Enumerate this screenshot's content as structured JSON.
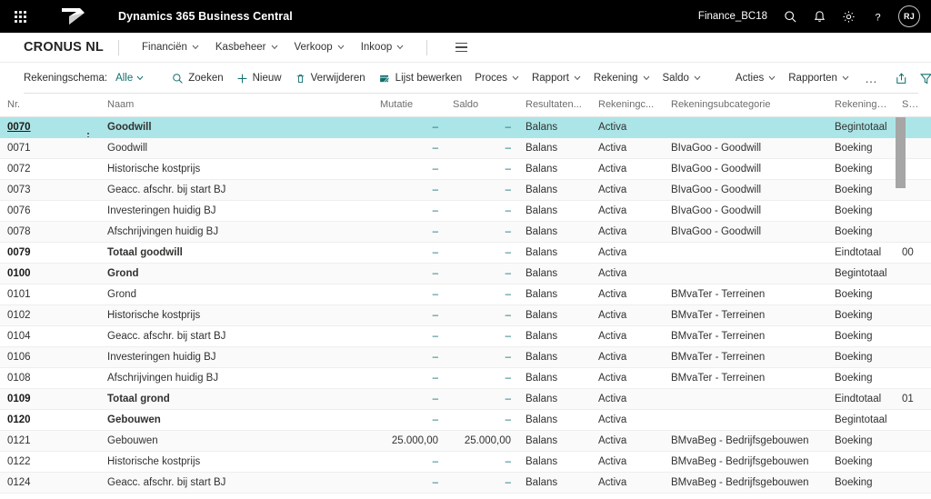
{
  "topbar": {
    "waffle_label": "App launcher",
    "app_title": "Dynamics 365 Business Central",
    "environment": "Finance_BC18",
    "search_icon": "search-icon",
    "notifications_icon": "bell-icon",
    "settings_icon": "gear-icon",
    "help_icon": "question-icon",
    "avatar_initials": "RJ"
  },
  "navbar": {
    "company": "CRONUS NL",
    "items": [
      {
        "label": "Financiën",
        "caret": "⌄"
      },
      {
        "label": "Kasbeheer",
        "caret": "⌄"
      },
      {
        "label": "Verkoop",
        "caret": "⌄"
      },
      {
        "label": "Inkoop",
        "caret": "⌄"
      }
    ],
    "menu_icon": "hamburger-icon"
  },
  "toolbar": {
    "view_label": "Rekeningschema:",
    "view_value": "Alle",
    "buttons": [
      {
        "label": "Zoeken",
        "icon": "search-icon"
      },
      {
        "label": "Nieuw",
        "icon": "plus-icon"
      },
      {
        "label": "Verwijderen",
        "icon": "trash-icon"
      },
      {
        "label": "Lijst bewerken",
        "icon": "edit-list-icon"
      },
      {
        "label": "Proces",
        "icon": "chevron-down-icon"
      },
      {
        "label": "Rapport",
        "icon": "chevron-down-icon"
      },
      {
        "label": "Rekening",
        "icon": "chevron-down-icon"
      },
      {
        "label": "Saldo",
        "icon": "chevron-down-icon"
      }
    ],
    "buttons2": [
      {
        "label": "Acties",
        "icon": "chevron-down-icon"
      },
      {
        "label": "Rapporten",
        "icon": "chevron-down-icon"
      }
    ],
    "overflow": "…",
    "icons": [
      {
        "name": "share-icon"
      },
      {
        "name": "filter-icon"
      },
      {
        "name": "info-icon"
      },
      {
        "name": "collapse-icon"
      },
      {
        "name": "bookmark-icon"
      }
    ],
    "accent_color": "#0f6e6e"
  },
  "grid": {
    "columns": [
      {
        "key": "nr",
        "label": "Nr.",
        "align": "left"
      },
      {
        "key": "naam",
        "label": "Naam",
        "align": "left"
      },
      {
        "key": "mutatie",
        "label": "Mutatie",
        "align": "right"
      },
      {
        "key": "saldo",
        "label": "Saldo",
        "align": "right"
      },
      {
        "key": "res",
        "label": "Resultaten...",
        "align": "left"
      },
      {
        "key": "cat",
        "label": "Rekeningc...",
        "align": "left"
      },
      {
        "key": "subcat",
        "label": "Rekeningsubcategorie",
        "align": "left"
      },
      {
        "key": "type",
        "label": "Rekenings...",
        "align": "left"
      },
      {
        "key": "same",
        "label": "Same",
        "align": "left"
      }
    ],
    "selected_row_color": "#ace5e7",
    "rows": [
      {
        "nr": "0070",
        "naam": "Goodwill",
        "mutatie": "–",
        "saldo": "–",
        "res": "Balans",
        "cat": "Activa",
        "subcat": "",
        "type": "Begintotaal",
        "same": "",
        "bold": true,
        "selected": true
      },
      {
        "nr": "0071",
        "naam": "Goodwill",
        "mutatie": "–",
        "saldo": "–",
        "res": "Balans",
        "cat": "Activa",
        "subcat": "BIvaGoo - Goodwill",
        "type": "Boeking",
        "same": "",
        "bold": false,
        "selected": false
      },
      {
        "nr": "0072",
        "naam": "Historische kostprijs",
        "mutatie": "–",
        "saldo": "–",
        "res": "Balans",
        "cat": "Activa",
        "subcat": "BIvaGoo - Goodwill",
        "type": "Boeking",
        "same": "",
        "bold": false,
        "selected": false
      },
      {
        "nr": "0073",
        "naam": "Geacc. afschr. bij start BJ",
        "mutatie": "–",
        "saldo": "–",
        "res": "Balans",
        "cat": "Activa",
        "subcat": "BIvaGoo - Goodwill",
        "type": "Boeking",
        "same": "",
        "bold": false,
        "selected": false
      },
      {
        "nr": "0076",
        "naam": "Investeringen huidig BJ",
        "mutatie": "–",
        "saldo": "–",
        "res": "Balans",
        "cat": "Activa",
        "subcat": "BIvaGoo - Goodwill",
        "type": "Boeking",
        "same": "",
        "bold": false,
        "selected": false
      },
      {
        "nr": "0078",
        "naam": "Afschrijvingen huidig BJ",
        "mutatie": "–",
        "saldo": "–",
        "res": "Balans",
        "cat": "Activa",
        "subcat": "BIvaGoo - Goodwill",
        "type": "Boeking",
        "same": "",
        "bold": false,
        "selected": false
      },
      {
        "nr": "0079",
        "naam": "Totaal goodwill",
        "mutatie": "–",
        "saldo": "–",
        "res": "Balans",
        "cat": "Activa",
        "subcat": "",
        "type": "Eindtotaal",
        "same": "00",
        "bold": true,
        "selected": false
      },
      {
        "nr": "0100",
        "naam": "Grond",
        "mutatie": "–",
        "saldo": "–",
        "res": "Balans",
        "cat": "Activa",
        "subcat": "",
        "type": "Begintotaal",
        "same": "",
        "bold": true,
        "selected": false
      },
      {
        "nr": "0101",
        "naam": "Grond",
        "mutatie": "–",
        "saldo": "–",
        "res": "Balans",
        "cat": "Activa",
        "subcat": "BMvaTer - Terreinen",
        "type": "Boeking",
        "same": "",
        "bold": false,
        "selected": false
      },
      {
        "nr": "0102",
        "naam": "Historische kostprijs",
        "mutatie": "–",
        "saldo": "–",
        "res": "Balans",
        "cat": "Activa",
        "subcat": "BMvaTer - Terreinen",
        "type": "Boeking",
        "same": "",
        "bold": false,
        "selected": false
      },
      {
        "nr": "0104",
        "naam": "Geacc. afschr. bij start BJ",
        "mutatie": "–",
        "saldo": "–",
        "res": "Balans",
        "cat": "Activa",
        "subcat": "BMvaTer - Terreinen",
        "type": "Boeking",
        "same": "",
        "bold": false,
        "selected": false
      },
      {
        "nr": "0106",
        "naam": "Investeringen huidig BJ",
        "mutatie": "–",
        "saldo": "–",
        "res": "Balans",
        "cat": "Activa",
        "subcat": "BMvaTer - Terreinen",
        "type": "Boeking",
        "same": "",
        "bold": false,
        "selected": false
      },
      {
        "nr": "0108",
        "naam": "Afschrijvingen huidig BJ",
        "mutatie": "–",
        "saldo": "–",
        "res": "Balans",
        "cat": "Activa",
        "subcat": "BMvaTer - Terreinen",
        "type": "Boeking",
        "same": "",
        "bold": false,
        "selected": false
      },
      {
        "nr": "0109",
        "naam": "Totaal grond",
        "mutatie": "–",
        "saldo": "–",
        "res": "Balans",
        "cat": "Activa",
        "subcat": "",
        "type": "Eindtotaal",
        "same": "01",
        "bold": true,
        "selected": false
      },
      {
        "nr": "0120",
        "naam": "Gebouwen",
        "mutatie": "–",
        "saldo": "–",
        "res": "Balans",
        "cat": "Activa",
        "subcat": "",
        "type": "Begintotaal",
        "same": "",
        "bold": true,
        "selected": false
      },
      {
        "nr": "0121",
        "naam": "Gebouwen",
        "mutatie": "25.000,00",
        "saldo": "25.000,00",
        "res": "Balans",
        "cat": "Activa",
        "subcat": "BMvaBeg - Bedrijfsgebouwen",
        "type": "Boeking",
        "same": "",
        "bold": false,
        "selected": false
      },
      {
        "nr": "0122",
        "naam": "Historische kostprijs",
        "mutatie": "–",
        "saldo": "–",
        "res": "Balans",
        "cat": "Activa",
        "subcat": "BMvaBeg - Bedrijfsgebouwen",
        "type": "Boeking",
        "same": "",
        "bold": false,
        "selected": false
      },
      {
        "nr": "0124",
        "naam": "Geacc. afschr. bij start BJ",
        "mutatie": "–",
        "saldo": "–",
        "res": "Balans",
        "cat": "Activa",
        "subcat": "BMvaBeg - Bedrijfsgebouwen",
        "type": "Boeking",
        "same": "",
        "bold": false,
        "selected": false
      }
    ]
  }
}
